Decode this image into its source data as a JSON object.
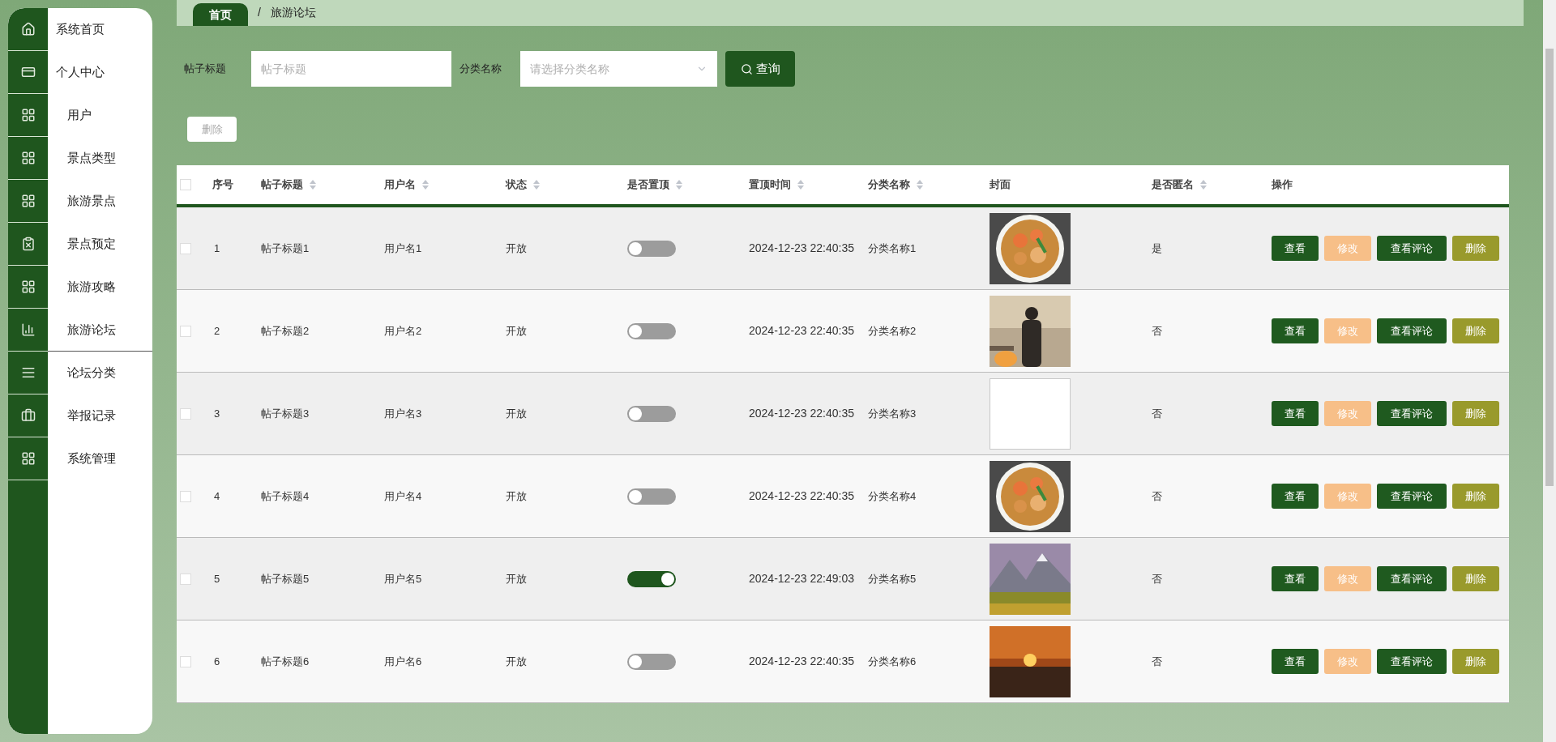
{
  "sidebar": {
    "items": [
      {
        "label": "系统首页",
        "kind": "top",
        "selected": false
      },
      {
        "label": "个人中心",
        "kind": "top",
        "selected": false
      },
      {
        "label": "用户",
        "kind": "menu",
        "selected": false
      },
      {
        "label": "景点类型",
        "kind": "menu",
        "selected": false
      },
      {
        "label": "旅游景点",
        "kind": "menu",
        "selected": false
      },
      {
        "label": "景点预定",
        "kind": "menu",
        "selected": false
      },
      {
        "label": "旅游攻略",
        "kind": "menu",
        "selected": false
      },
      {
        "label": "旅游论坛",
        "kind": "menu",
        "selected": true
      },
      {
        "label": "论坛分类",
        "kind": "menu",
        "selected": false
      },
      {
        "label": "举报记录",
        "kind": "menu",
        "selected": false
      },
      {
        "label": "系统管理",
        "kind": "menu",
        "selected": false
      }
    ]
  },
  "breadcrumb": {
    "home": "首页",
    "separator": "/",
    "current": "旅游论坛"
  },
  "search": {
    "fields": [
      {
        "label": "帖子标题",
        "kind": "input",
        "placeholder": "帖子标题"
      },
      {
        "label": "分类名称",
        "kind": "select",
        "placeholder": "请选择分类名称"
      }
    ],
    "button": "查询"
  },
  "delete_button": {
    "label": "删除",
    "disabled": true
  },
  "table": {
    "select_all_checked": false,
    "columns": [
      {
        "kind": "checkbox"
      },
      {
        "label": "序号",
        "sortable": false
      },
      {
        "label": "帖子标题",
        "sortable": true
      },
      {
        "label": "用户名",
        "sortable": true
      },
      {
        "label": "状态",
        "sortable": true
      },
      {
        "label": "是否置顶",
        "sortable": true
      },
      {
        "label": "置顶时间",
        "sortable": true
      },
      {
        "label": "分类名称",
        "sortable": true
      },
      {
        "label": "封面",
        "sortable": false
      },
      {
        "label": "是否匿名",
        "sortable": true
      },
      {
        "label": "操作",
        "sortable": false
      }
    ],
    "rows": [
      {
        "checked": false,
        "index": "1",
        "title": "帖子标题1",
        "user": "用户名1",
        "status": "开放",
        "pinned": false,
        "time": "2024-12-23 22:40:35",
        "category": "分类名称1",
        "cover": {
          "kind": "food"
        },
        "anonymous": "是",
        "actions": [
          {
            "label": "查看",
            "kind": "view"
          },
          {
            "label": "修改",
            "kind": "edit"
          },
          {
            "label": "查看评论",
            "kind": "comments"
          },
          {
            "label": "删除",
            "kind": "delete"
          }
        ]
      },
      {
        "checked": false,
        "index": "2",
        "title": "帖子标题2",
        "user": "用户名2",
        "status": "开放",
        "pinned": false,
        "time": "2024-12-23 22:40:35",
        "category": "分类名称2",
        "cover": {
          "kind": "figure"
        },
        "anonymous": "否",
        "actions": [
          {
            "label": "查看",
            "kind": "view"
          },
          {
            "label": "修改",
            "kind": "edit"
          },
          {
            "label": "查看评论",
            "kind": "comments"
          },
          {
            "label": "删除",
            "kind": "delete"
          }
        ]
      },
      {
        "checked": false,
        "index": "3",
        "title": "帖子标题3",
        "user": "用户名3",
        "status": "开放",
        "pinned": false,
        "time": "2024-12-23 22:40:35",
        "category": "分类名称3",
        "cover": {
          "kind": "broken"
        },
        "anonymous": "否",
        "actions": [
          {
            "label": "查看",
            "kind": "view"
          },
          {
            "label": "修改",
            "kind": "edit"
          },
          {
            "label": "查看评论",
            "kind": "comments"
          },
          {
            "label": "删除",
            "kind": "delete"
          }
        ]
      },
      {
        "checked": false,
        "index": "4",
        "title": "帖子标题4",
        "user": "用户名4",
        "status": "开放",
        "pinned": false,
        "time": "2024-12-23 22:40:35",
        "category": "分类名称4",
        "cover": {
          "kind": "food"
        },
        "anonymous": "否",
        "actions": [
          {
            "label": "查看",
            "kind": "view"
          },
          {
            "label": "修改",
            "kind": "edit"
          },
          {
            "label": "查看评论",
            "kind": "comments"
          },
          {
            "label": "删除",
            "kind": "delete"
          }
        ]
      },
      {
        "checked": false,
        "index": "5",
        "title": "帖子标题5",
        "user": "用户名5",
        "status": "开放",
        "pinned": true,
        "time": "2024-12-23 22:49:03",
        "category": "分类名称5",
        "cover": {
          "kind": "mountain"
        },
        "anonymous": "否",
        "actions": [
          {
            "label": "查看",
            "kind": "view"
          },
          {
            "label": "修改",
            "kind": "edit"
          },
          {
            "label": "查看评论",
            "kind": "comments"
          },
          {
            "label": "删除",
            "kind": "delete"
          }
        ]
      },
      {
        "checked": false,
        "index": "6",
        "title": "帖子标题6",
        "user": "用户名6",
        "status": "开放",
        "pinned": false,
        "time": "2024-12-23 22:40:35",
        "category": "分类名称6",
        "cover": {
          "kind": "sunset"
        },
        "anonymous": "否",
        "actions": [
          {
            "label": "查看",
            "kind": "view"
          },
          {
            "label": "修改",
            "kind": "edit"
          },
          {
            "label": "查看评论",
            "kind": "comments"
          },
          {
            "label": "删除",
            "kind": "delete"
          }
        ]
      }
    ]
  }
}
